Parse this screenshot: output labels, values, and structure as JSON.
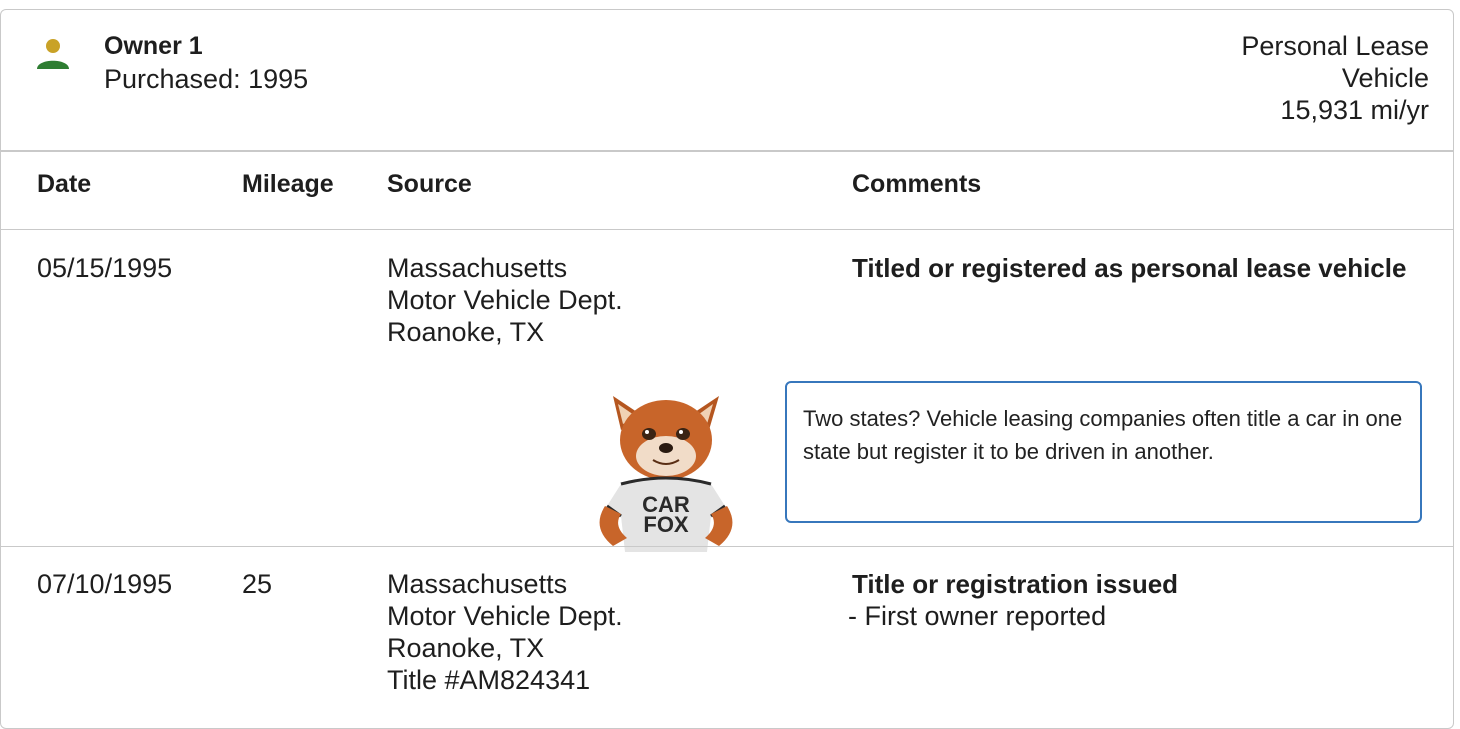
{
  "owner": {
    "name": "Owner 1",
    "purchased": "Purchased: 1995",
    "type_line1": "Personal Lease",
    "type_line2": "Vehicle",
    "miles_per_year": "15,931 mi/yr",
    "icon": "person-icon",
    "icon_colors": {
      "head": "#c9a227",
      "body": "#2e7d32"
    }
  },
  "table": {
    "headers": {
      "date": "Date",
      "mileage": "Mileage",
      "source": "Source",
      "comments": "Comments"
    },
    "rows": [
      {
        "date": "05/15/1995",
        "mileage": "",
        "source": [
          "Massachusetts",
          "Motor Vehicle Dept.",
          "Roanoke, TX"
        ],
        "comment_title": "Titled or registered as personal lease vehicle",
        "comment_details": []
      },
      {
        "date": "07/10/1995",
        "mileage": "25",
        "source": [
          "Massachusetts",
          "Motor Vehicle Dept.",
          "Roanoke, TX",
          "Title #AM824341"
        ],
        "comment_title": "Title or registration issued",
        "comment_details": [
          "- First owner reported"
        ]
      }
    ]
  },
  "tip": {
    "text": "Two states? Vehicle leasing companies often title a car in one state but register it to be driven in another.",
    "mascot_shirt_line1": "CAR",
    "mascot_shirt_line2": "FOX",
    "border_color": "#3777bc"
  }
}
